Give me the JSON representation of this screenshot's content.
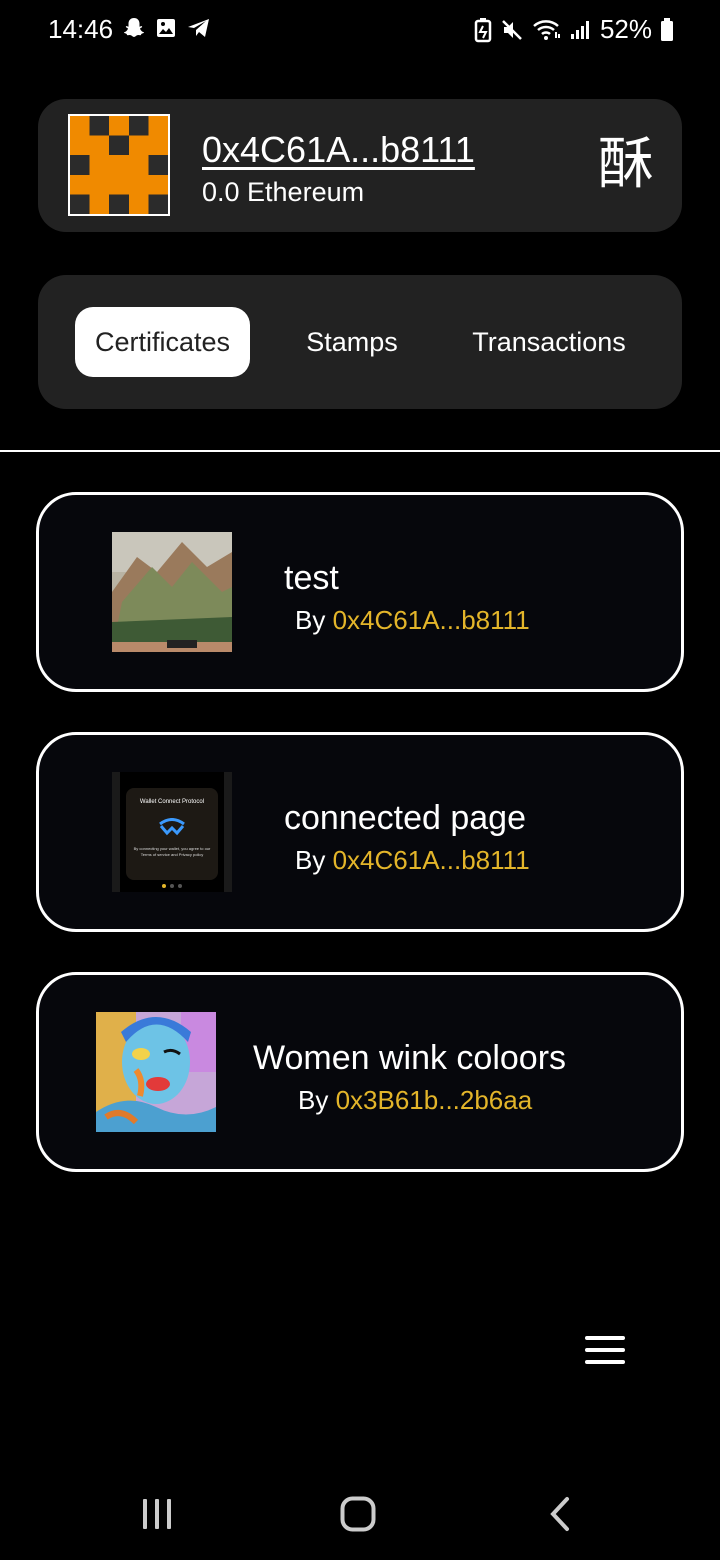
{
  "status_bar": {
    "time": "14:46",
    "battery": "52%",
    "left_icons": [
      "snapchat-icon",
      "gallery-icon",
      "telegram-icon"
    ],
    "right_icons": [
      "battery-saver-icon",
      "mute-icon",
      "wifi-icon",
      "signal-icon",
      "battery-icon"
    ]
  },
  "wallet": {
    "address": "0x4C61A...b8111",
    "balance": "0.0 Ethereum",
    "language_button": "酥"
  },
  "tabs": [
    {
      "label": "Certificates",
      "active": true
    },
    {
      "label": "Stamps",
      "active": false
    },
    {
      "label": "Transactions",
      "active": false
    }
  ],
  "certificates": [
    {
      "title": "test",
      "by_prefix": "By ",
      "author": "0x4C61A...b8111"
    },
    {
      "title": "connected page",
      "by_prefix": "By ",
      "author": "0x4C61A...b8111",
      "thumb_text": {
        "heading": "Wallet Connect Protocol",
        "body": "By connecting your wallet, you agree to our Terms of service and Privacy policy"
      }
    },
    {
      "title": "Women wink coloors",
      "by_prefix": "By ",
      "author": "0x3B61b...2b6aa"
    }
  ],
  "colors": {
    "background": "#000000",
    "card": "#222222",
    "author_accent": "#e3b52a",
    "avatar_orange": "#f08a00"
  }
}
